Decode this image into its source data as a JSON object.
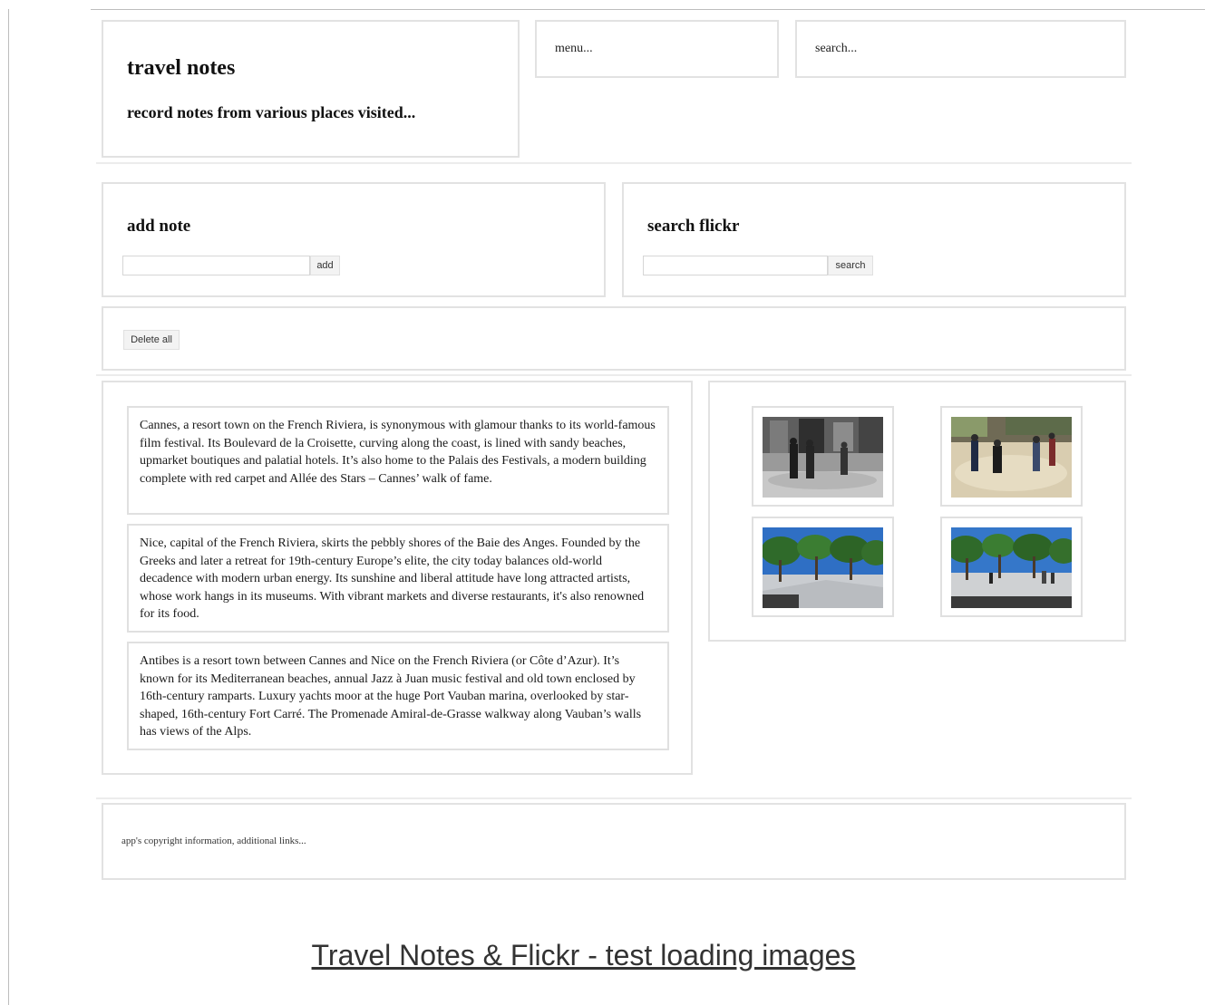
{
  "header": {
    "title": "travel notes",
    "subtitle": "record notes from various places visited...",
    "menu_placeholder": "menu...",
    "search_placeholder": "search..."
  },
  "add_note": {
    "title": "add note",
    "input_value": "",
    "button_label": "add"
  },
  "search_flickr": {
    "title": "search flickr",
    "input_value": "",
    "button_label": "search"
  },
  "controls": {
    "delete_all_label": "Delete all"
  },
  "notes": [
    "Cannes, a resort town on the French Riviera, is synonymous with glamour thanks to its world-famous film festival. Its Boulevard de la Croisette, curving along the coast, is lined with sandy beaches, upmarket boutiques and palatial hotels. It’s also home to the Palais des Festivals, a modern building complete with red carpet and Allée des Stars – Cannes’ walk of fame.",
    "Nice, capital of the French Riviera, skirts the pebbly shores of the Baie des Anges. Founded by the Greeks and later a retreat for 19th-century Europe’s elite, the city today balances old-world decadence with modern urban energy. Its sunshine and liberal attitude have long attracted artists, whose work hangs in its museums. With vibrant markets and diverse restaurants, it's also renowned for its food.",
    "Antibes is a resort town between Cannes and Nice on the French Riviera (or Côte d’Azur). It’s known for its Mediterranean beaches, annual Jazz à Juan music festival and old town enclosed by 16th-century ramparts. Luxury yachts moor at the huge Port Vauban marina, overlooked by star-shaped, 16th-century Fort Carré. The Promenade Amiral-de-Grasse walkway along Vauban’s walls has views of the Alps."
  ],
  "gallery": {
    "images": [
      {
        "subject": "black-and-white photo of men playing petanque"
      },
      {
        "subject": "color photo of men playing petanque in a square"
      },
      {
        "subject": "park square with trees under blue sky"
      },
      {
        "subject": "park square with trees and people under blue sky"
      }
    ]
  },
  "footer": {
    "text": "app's copyright information, additional links..."
  },
  "caption": {
    "link_text": "Travel Notes & Flickr - test loading images"
  }
}
